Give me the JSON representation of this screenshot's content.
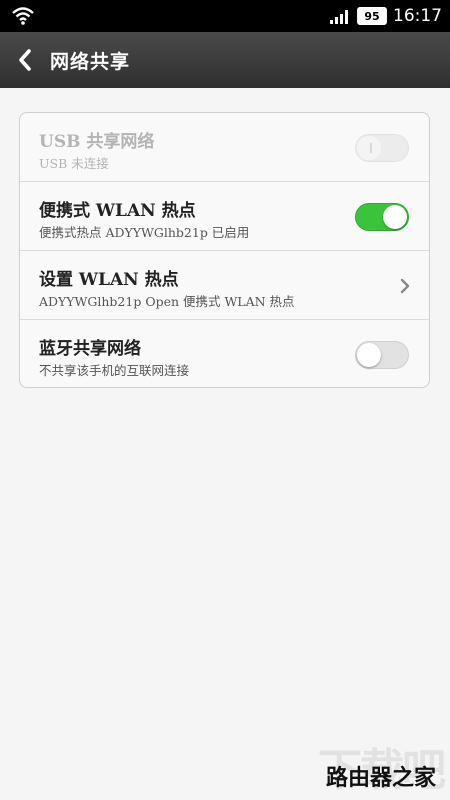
{
  "status_bar": {
    "battery": "95",
    "time": "16:17"
  },
  "header": {
    "title": "网络共享",
    "back_icon": "chevron-left-icon"
  },
  "settings": [
    {
      "title": "USB 共享网络",
      "subtitle": "USB 未连接",
      "control": "toggle",
      "state": "disabled"
    },
    {
      "title": "便携式 WLAN 热点",
      "subtitle": "便携式热点 ADYYWGlhb21p 已启用",
      "control": "toggle",
      "state": "on"
    },
    {
      "title": "设置 WLAN 热点",
      "subtitle": "ADYYWGlhb21p Open 便携式 WLAN 热点",
      "control": "chevron",
      "state": ""
    },
    {
      "title": "蓝牙共享网络",
      "subtitle": "不共享该手机的互联网连接",
      "control": "toggle",
      "state": "off"
    }
  ],
  "colors": {
    "toggle_on": "#3bc43b",
    "title_bar": "#3a3a3a"
  },
  "watermark": {
    "back_text": "下载吧",
    "front_text": "路由器之家"
  }
}
